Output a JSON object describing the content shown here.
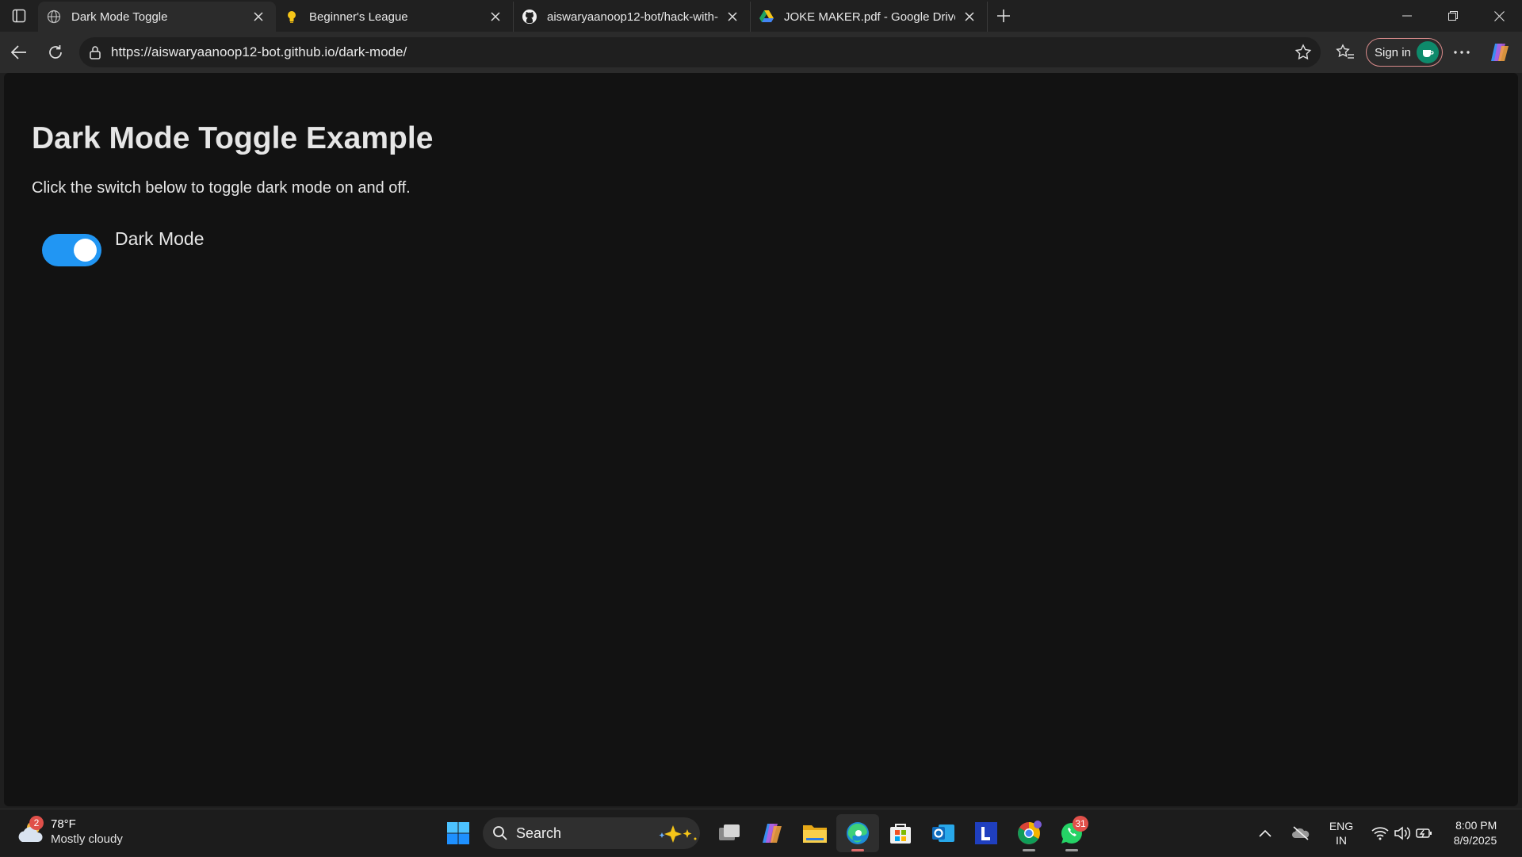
{
  "browser": {
    "tabs": [
      {
        "title": "Dark Mode Toggle",
        "icon": "globe-icon",
        "active": true
      },
      {
        "title": "Beginner's League",
        "icon": "lightbulb-icon",
        "active": false
      },
      {
        "title": "aiswaryaanoop12-bot/hack-with-",
        "icon": "github-icon",
        "active": false
      },
      {
        "title": "JOKE MAKER.pdf - Google Drive",
        "icon": "google-drive-icon",
        "active": false
      }
    ],
    "url": "https://aiswaryaanoop12-bot.github.io/dark-mode/",
    "signin_label": "Sign in"
  },
  "page": {
    "title": "Dark Mode Toggle Example",
    "description": "Click the switch below to toggle dark mode on and off.",
    "toggle": {
      "label": "Dark Mode",
      "checked": true,
      "color": "#2196f3"
    },
    "background": "#121212"
  },
  "taskbar": {
    "weather": {
      "temp": "78°F",
      "condition": "Mostly cloudy",
      "badge": "2"
    },
    "search_label": "Search",
    "apps": [
      {
        "name": "task-view-icon"
      },
      {
        "name": "copilot-icon"
      },
      {
        "name": "file-explorer-icon"
      },
      {
        "name": "edge-icon",
        "active": true
      },
      {
        "name": "microsoft-store-icon"
      },
      {
        "name": "outlook-icon"
      },
      {
        "name": "l-app-icon"
      },
      {
        "name": "chrome-icon"
      },
      {
        "name": "whatsapp-icon",
        "badge": "31"
      }
    ],
    "language": {
      "line1": "ENG",
      "line2": "IN"
    },
    "clock": {
      "time": "8:00 PM",
      "date": "8/9/2025"
    }
  }
}
